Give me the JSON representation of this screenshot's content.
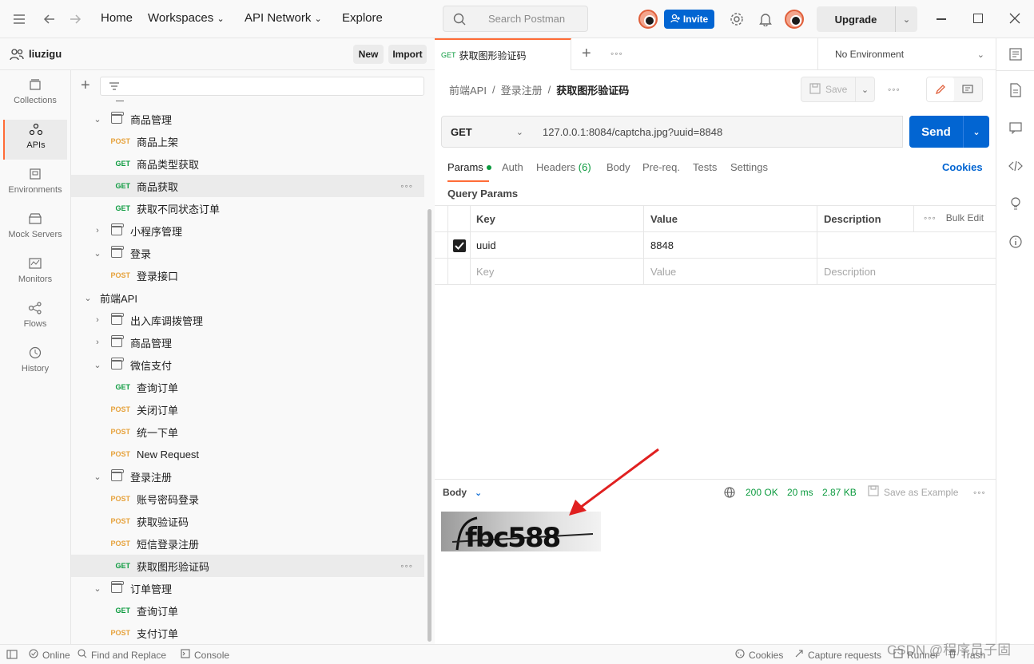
{
  "nav": {
    "home": "Home",
    "workspaces": "Workspaces",
    "api_network": "API Network",
    "explore": "Explore",
    "search_placeholder": "Search Postman",
    "invite": "Invite",
    "upgrade": "Upgrade"
  },
  "workspace": {
    "user": "liuzigu",
    "new": "New",
    "import": "Import"
  },
  "rail": [
    {
      "label": "Collections",
      "icon": "collections-icon"
    },
    {
      "label": "APIs",
      "icon": "apis-icon",
      "active": true
    },
    {
      "label": "Environments",
      "icon": "environments-icon"
    },
    {
      "label": "Mock Servers",
      "icon": "mock-servers-icon"
    },
    {
      "label": "Monitors",
      "icon": "monitors-icon"
    },
    {
      "label": "Flows",
      "icon": "flows-icon"
    },
    {
      "label": "History",
      "icon": "history-icon"
    }
  ],
  "tree": [
    {
      "type": "folder",
      "label": "商品管理",
      "open": true,
      "indent": 1
    },
    {
      "type": "req",
      "method": "POST",
      "label": "商品上架",
      "indent": 2
    },
    {
      "type": "req",
      "method": "GET",
      "label": "商品类型获取",
      "indent": 2
    },
    {
      "type": "req",
      "method": "GET",
      "label": "商品获取",
      "indent": 2,
      "selected": true
    },
    {
      "type": "req",
      "method": "GET",
      "label": "获取不同状态订单",
      "indent": 2
    },
    {
      "type": "folder",
      "label": "小程序管理",
      "open": false,
      "indent": 1
    },
    {
      "type": "folder",
      "label": "登录",
      "open": true,
      "indent": 1
    },
    {
      "type": "req",
      "method": "POST",
      "label": "登录接口",
      "indent": 2
    },
    {
      "type": "api",
      "label": "前端API",
      "open": true,
      "indent": 0
    },
    {
      "type": "folder",
      "label": "出入库调拨管理",
      "open": false,
      "indent": 1
    },
    {
      "type": "folder",
      "label": "商品管理",
      "open": false,
      "indent": 1
    },
    {
      "type": "folder",
      "label": "微信支付",
      "open": true,
      "indent": 1
    },
    {
      "type": "req",
      "method": "GET",
      "label": "查询订单",
      "indent": 2
    },
    {
      "type": "req",
      "method": "POST",
      "label": "关闭订单",
      "indent": 2
    },
    {
      "type": "req",
      "method": "POST",
      "label": "统一下单",
      "indent": 2
    },
    {
      "type": "req",
      "method": "POST",
      "label": "New Request",
      "indent": 2
    },
    {
      "type": "folder",
      "label": "登录注册",
      "open": true,
      "indent": 1
    },
    {
      "type": "req",
      "method": "POST",
      "label": "账号密码登录",
      "indent": 2
    },
    {
      "type": "req",
      "method": "POST",
      "label": "获取验证码",
      "indent": 2
    },
    {
      "type": "req",
      "method": "POST",
      "label": "短信登录注册",
      "indent": 2
    },
    {
      "type": "req",
      "method": "GET",
      "label": "获取图形验证码",
      "indent": 2,
      "selected": true
    },
    {
      "type": "folder",
      "label": "订单管理",
      "open": true,
      "indent": 1
    },
    {
      "type": "req",
      "method": "GET",
      "label": "查询订单",
      "indent": 2
    },
    {
      "type": "req",
      "method": "POST",
      "label": "支付订单",
      "indent": 2
    }
  ],
  "tab": {
    "method": "GET",
    "title": "获取图形验证码"
  },
  "environment": "No Environment",
  "breadcrumb": {
    "p1": "前端API",
    "p2": "登录注册",
    "current": "获取图形验证码",
    "save": "Save"
  },
  "request": {
    "method": "GET",
    "url": "127.0.0.1:8084/captcha.jpg?uuid=8848",
    "send": "Send"
  },
  "reqtabs": {
    "params": "Params",
    "auth": "Auth",
    "headers": "Headers",
    "headers_count": "(6)",
    "body": "Body",
    "prereq": "Pre-req.",
    "tests": "Tests",
    "settings": "Settings",
    "cookies": "Cookies"
  },
  "query": {
    "title": "Query Params",
    "headers": {
      "key": "Key",
      "value": "Value",
      "description": "Description",
      "bulk": "Bulk Edit"
    },
    "row": {
      "key": "uuid",
      "value": "8848",
      "checked": true
    },
    "placeholders": {
      "key": "Key",
      "value": "Value",
      "description": "Description"
    }
  },
  "response": {
    "body": "Body",
    "status": "200 OK",
    "time": "20 ms",
    "size": "2.87 KB",
    "save_example": "Save as Example",
    "captcha_text": "fbc588"
  },
  "status": {
    "online": "Online",
    "find": "Find and Replace",
    "console": "Console",
    "cookies": "Cookies",
    "capture": "Capture requests",
    "runner": "Runner",
    "trash": "Trash",
    "watermark": "CSDN @程序员子固"
  },
  "colors": {
    "accent": "#ff6c37",
    "send": "#0265d2",
    "get": "#0b9a3e",
    "post": "#e6a23c"
  }
}
